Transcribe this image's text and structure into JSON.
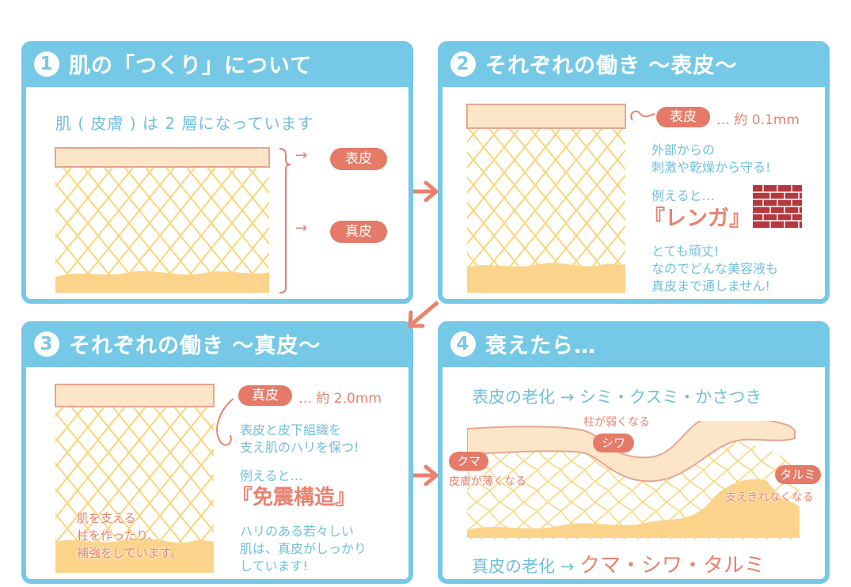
{
  "colors": {
    "panel_blue": "#76c9e6",
    "text_blue": "#70bfdc",
    "salmon": "#e57a68",
    "epidermis": "#fde6c8",
    "fat": "#fcd38a",
    "mesh": "#f8d67a",
    "brick": "#b5383f"
  },
  "panel1": {
    "number": "1",
    "title": "肌の「つくり」について",
    "subtitle": "肌 ( 皮膚 ) は 2 層になっています",
    "arrow1": "→",
    "arrow2": "→",
    "label_epidermis": "表皮",
    "label_dermis": "真皮"
  },
  "panel2": {
    "number": "2",
    "title": "それぞれの働き 〜表皮〜",
    "badge": "表皮",
    "size_text": "… 約 0.1mm",
    "desc1": "外部からの",
    "desc2": "刺激や乾燥から守る!",
    "example_intro": "例えると…",
    "example": "『レンガ』",
    "brick_icon": "brick-wall-icon",
    "desc3": "とても頑丈!",
    "desc4": "なのでどんな美容液も",
    "desc5": "真皮まで通しません!"
  },
  "panel3": {
    "number": "3",
    "title": "それぞれの働き 〜真皮〜",
    "badge": "真皮",
    "size_text": "… 約 2.0mm",
    "desc1": "表皮と皮下組織を",
    "desc2": "支え肌のハリを保つ!",
    "example_intro": "例えると…",
    "example": "『免震構造』",
    "desc3": "ハリのある若々しい",
    "desc4": "肌は、真皮がしっかり",
    "desc5": "しています!",
    "fig_text1": "肌を支える",
    "fig_text2": "柱を作ったり、",
    "fig_text3": "補強をしています。"
  },
  "panel4": {
    "number": "4",
    "title": "衰えたら…",
    "aging_epidermis_label": "表皮の老化",
    "aging_epidermis_arrow": "→",
    "aging_epidermis_items": "シミ・クスミ・かさつき",
    "pillar_note": "柱が弱くなる",
    "badge_shiwa": "シワ",
    "badge_kuma": "クマ",
    "kuma_note": "皮膚が薄くなる",
    "badge_tarumi": "タルミ",
    "tarumi_note": "支えきれなくなる",
    "aging_dermis_label": "真皮の老化",
    "aging_dermis_arrow": "→",
    "aging_dermis_items": "クマ・シワ・タルミ"
  }
}
